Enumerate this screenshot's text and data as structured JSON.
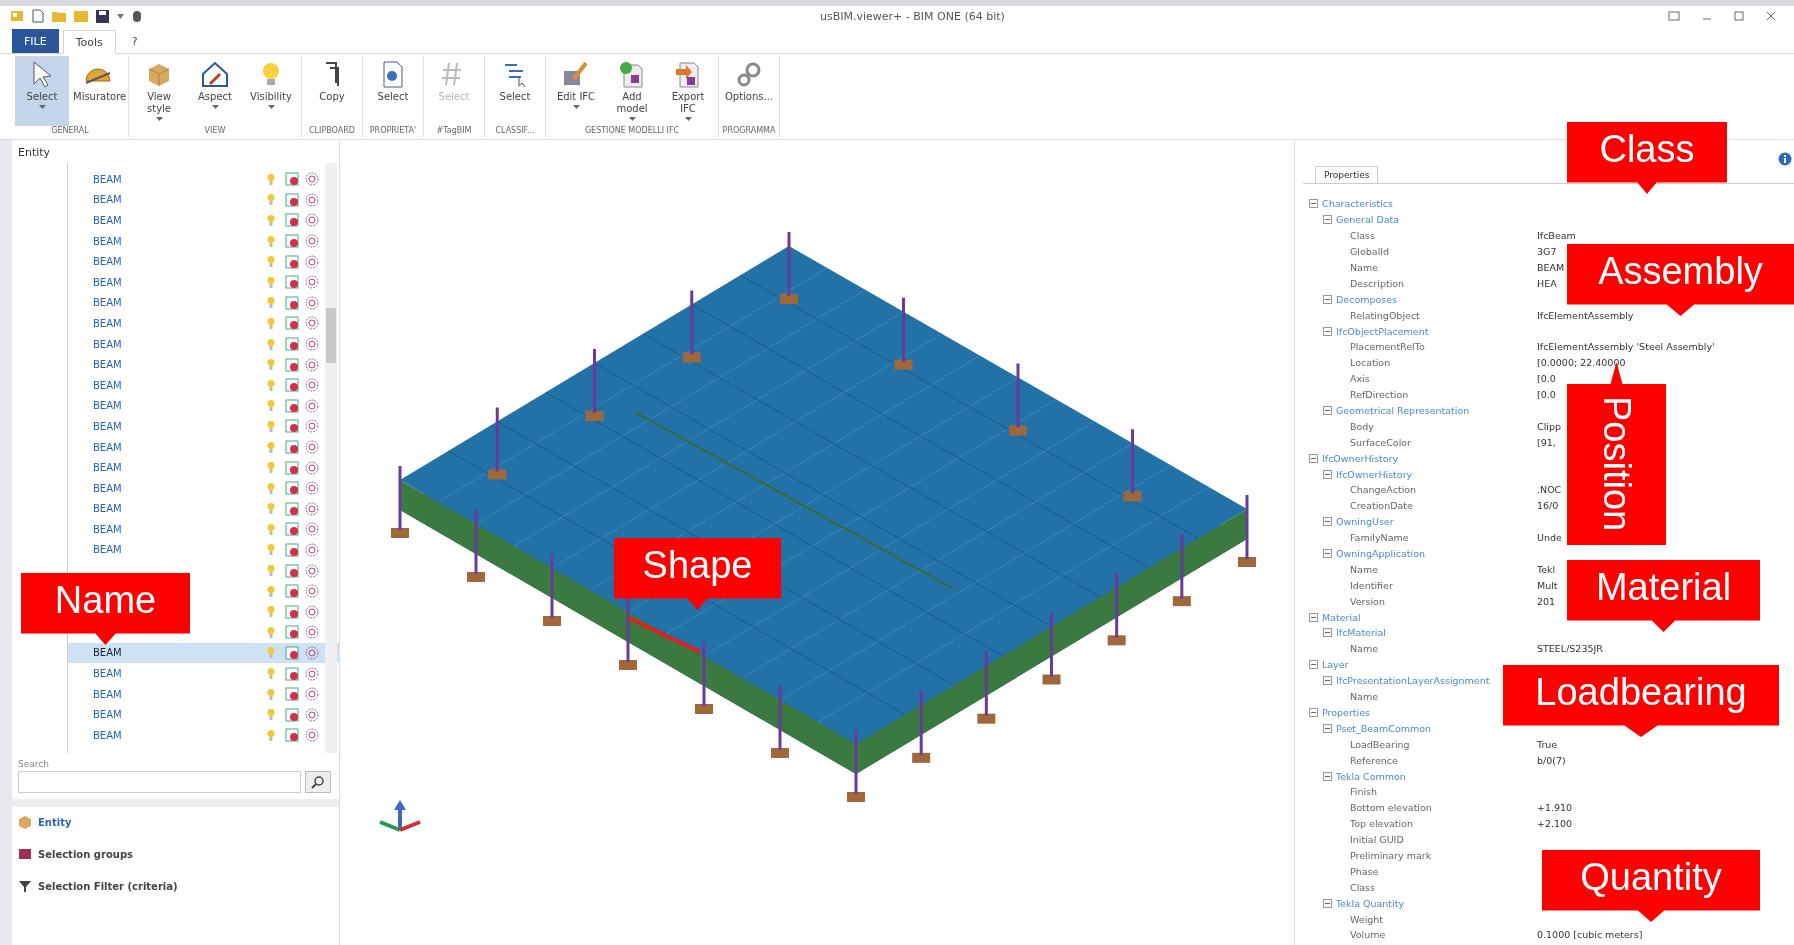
{
  "window": {
    "title": "usBIM.viewer+ - BIM ONE (64 bit)"
  },
  "tabs": [
    {
      "label": "FILE",
      "kind": "file",
      "selected": false
    },
    {
      "label": "Tools",
      "kind": "tab",
      "selected": true
    },
    {
      "label": "?",
      "kind": "tab",
      "selected": false
    }
  ],
  "ribbon": [
    {
      "label": "GENERAL",
      "buttons": [
        {
          "label": "Select",
          "kind": "cursor",
          "pressed": true,
          "dropdown": true
        },
        {
          "label": "Misuratore",
          "kind": "ruler",
          "pressed": false,
          "dropdown": false
        }
      ]
    },
    {
      "label": "VIEW",
      "buttons": [
        {
          "label": "View style",
          "kind": "cube",
          "pressed": false,
          "dropdown": true
        },
        {
          "label": "Aspect",
          "kind": "house",
          "pressed": false,
          "dropdown": true
        },
        {
          "label": "Visibility",
          "kind": "bulb",
          "pressed": false,
          "dropdown": true
        }
      ]
    },
    {
      "label": "CLIPBOARD",
      "buttons": [
        {
          "label": "Copy",
          "kind": "copy",
          "pressed": false,
          "dropdown": false
        }
      ]
    },
    {
      "label": "PROPRIETA'",
      "buttons": [
        {
          "label": "Select",
          "kind": "doc",
          "pressed": false,
          "dropdown": false
        }
      ]
    },
    {
      "label": "#TagBIM",
      "buttons": [
        {
          "label": "Select",
          "kind": "tag",
          "pressed": false,
          "dropdown": false,
          "disabled": true
        }
      ]
    },
    {
      "label": "CLASSIF...",
      "buttons": [
        {
          "label": "Select",
          "kind": "list",
          "pressed": false,
          "dropdown": false
        }
      ]
    },
    {
      "label": "GESTIONE MODELLI IFC",
      "buttons": [
        {
          "label": "Edit IFC",
          "kind": "edit",
          "pressed": false,
          "dropdown": true
        },
        {
          "label": "Add model",
          "kind": "add",
          "pressed": false,
          "dropdown": true
        },
        {
          "label": "Export IFC",
          "kind": "export",
          "pressed": false,
          "dropdown": true
        }
      ]
    },
    {
      "label": "PROGRAMMA",
      "buttons": [
        {
          "label": "Options...",
          "kind": "gears",
          "pressed": false,
          "dropdown": false
        }
      ]
    }
  ],
  "entity_panel": {
    "title": "Entity",
    "rows": [
      {
        "name": "BEAM",
        "selected": false
      },
      {
        "name": "BEAM",
        "selected": false
      },
      {
        "name": "BEAM",
        "selected": false
      },
      {
        "name": "BEAM",
        "selected": false
      },
      {
        "name": "BEAM",
        "selected": false
      },
      {
        "name": "BEAM",
        "selected": false
      },
      {
        "name": "BEAM",
        "selected": false
      },
      {
        "name": "BEAM",
        "selected": false
      },
      {
        "name": "BEAM",
        "selected": false
      },
      {
        "name": "BEAM",
        "selected": false
      },
      {
        "name": "BEAM",
        "selected": false
      },
      {
        "name": "BEAM",
        "selected": false
      },
      {
        "name": "BEAM",
        "selected": false
      },
      {
        "name": "BEAM",
        "selected": false
      },
      {
        "name": "BEAM",
        "selected": false
      },
      {
        "name": "BEAM",
        "selected": false
      },
      {
        "name": "BEAM",
        "selected": false
      },
      {
        "name": "BEAM",
        "selected": false
      },
      {
        "name": "BEAM",
        "selected": false
      },
      {
        "selected": false
      },
      {
        "selected": false
      },
      {
        "selected": false
      },
      {
        "selected": false
      },
      {
        "name": "BEAM",
        "selected": true
      },
      {
        "name": "BEAM",
        "selected": false
      },
      {
        "name": "BEAM",
        "selected": false
      },
      {
        "name": "BEAM",
        "selected": false
      },
      {
        "name": "BEAM",
        "selected": false
      }
    ],
    "search": {
      "label": "Search"
    },
    "nav": [
      {
        "label": "Entity",
        "kind": "box",
        "selected": true
      },
      {
        "label": "Selection groups",
        "kind": "flag",
        "selected": false
      },
      {
        "label": "Selection Filter (criteria)",
        "kind": "filter",
        "selected": false
      }
    ]
  },
  "properties": {
    "tab": "Properties",
    "tree": [
      {
        "label": "Characteristics",
        "expanded": true,
        "children": [
          {
            "label": "General Data",
            "expanded": true,
            "children": [
              {
                "label": "Class",
                "value": "IfcBeam"
              },
              {
                "label": "GlobalId",
                "value": "3G7"
              },
              {
                "label": "Name",
                "value": "BEAM"
              },
              {
                "label": "Description",
                "value": "HEA"
              }
            ]
          },
          {
            "label": "Decomposes",
            "expanded": true,
            "children": [
              {
                "label": "RelatingObject",
                "value": "IfcElementAssembly"
              }
            ]
          },
          {
            "label": "IfcObjectPlacement",
            "expanded": true,
            "children": [
              {
                "label": "PlacementRelTo",
                "value": "IfcElementAssembly 'Steel Assembly'"
              },
              {
                "label": "Location",
                "value": "[0.0000; 22.40000"
              },
              {
                "label": "Axis",
                "value": "[0.0"
              },
              {
                "label": "RefDirection",
                "value": "[0.0"
              }
            ]
          },
          {
            "label": "Geometrical Representation",
            "expanded": true,
            "children": [
              {
                "label": "Body",
                "value": "Clipp"
              },
              {
                "label": "SurfaceColor",
                "value": "[91,"
              }
            ]
          }
        ]
      },
      {
        "label": "IfcOwnerHistory",
        "expanded": true,
        "children": [
          {
            "label": "IfcOwnerHistory",
            "expanded": true,
            "children": [
              {
                "label": "ChangeAction",
                "value": ".NOC"
              },
              {
                "label": "CreationDate",
                "value": "16/0"
              }
            ]
          },
          {
            "label": "OwningUser",
            "expanded": true,
            "children": [
              {
                "label": "FamilyName",
                "value": "Unde"
              }
            ]
          },
          {
            "label": "OwningApplication",
            "expanded": true,
            "children": [
              {
                "label": "Name",
                "value": "Tekl"
              },
              {
                "label": "Identifier",
                "value": "Mult"
              },
              {
                "label": "Version",
                "value": "201"
              }
            ]
          }
        ]
      },
      {
        "label": "Material",
        "expanded": true,
        "children": [
          {
            "label": "IfcMaterial",
            "expanded": true,
            "children": [
              {
                "label": "Name",
                "value": "STEEL/S235JR"
              }
            ]
          }
        ]
      },
      {
        "label": "Layer",
        "expanded": true,
        "children": [
          {
            "label": "IfcPresentationLayerAssignment",
            "expanded": true,
            "children": [
              {
                "label": "Name"
              }
            ]
          }
        ]
      },
      {
        "label": "Properties",
        "expanded": true,
        "children": [
          {
            "label": "Pset_BeamCommon",
            "expanded": true,
            "children": [
              {
                "label": "LoadBearing",
                "value": "True"
              },
              {
                "label": "Reference",
                "value": "b/0(7)"
              }
            ]
          },
          {
            "label": "Tekla Common",
            "expanded": true,
            "children": [
              {
                "label": "Finish"
              },
              {
                "label": "Bottom elevation",
                "value": "+1.910"
              },
              {
                "label": "Top elevation",
                "value": "+2.100"
              },
              {
                "label": "Initial GUID"
              },
              {
                "label": "Preliminary mark"
              },
              {
                "label": "Phase"
              },
              {
                "label": "Class"
              }
            ]
          },
          {
            "label": "Tekla Quantity",
            "expanded": true,
            "children": [
              {
                "label": "Weight"
              },
              {
                "label": "Volume",
                "value": "0.1000 [cubic meters]"
              }
            ]
          }
        ]
      }
    ]
  },
  "callouts": [
    {
      "text": "Class",
      "kind": "down"
    },
    {
      "text": "Assembly",
      "kind": "down"
    },
    {
      "text": "Position",
      "kind": "vertical"
    },
    {
      "text": "Material",
      "kind": "down"
    },
    {
      "text": "Loadbearing",
      "kind": "down"
    },
    {
      "text": "Quantity",
      "kind": "down"
    },
    {
      "text": "Name",
      "kind": "down"
    },
    {
      "text": "Shape",
      "kind": "down"
    }
  ]
}
